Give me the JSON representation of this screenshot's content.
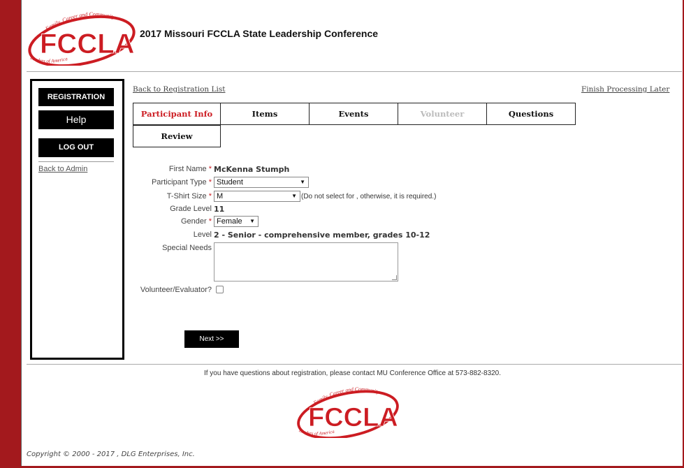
{
  "brand": {
    "logo_text": "FCCLA",
    "logo_arc_text": "Family, Career and Community",
    "logo_sub_text": "Leaders of America",
    "accent_color": "#cc1c22",
    "border_color": "#a3191d"
  },
  "header": {
    "title": "2017 Missouri FCCLA State Leadership Conference"
  },
  "sidebar": {
    "registration_label": "REGISTRATION",
    "help_label": "Help",
    "logout_label": "LOG OUT",
    "back_admin_label": "Back to Admin"
  },
  "top_links": {
    "back_to_list": "Back to Registration List",
    "finish_later": "Finish Processing Later"
  },
  "tabs": [
    {
      "label": "Participant Info",
      "state": "active"
    },
    {
      "label": "Items",
      "state": "normal"
    },
    {
      "label": "Events",
      "state": "normal"
    },
    {
      "label": "Volunteer",
      "state": "disabled"
    },
    {
      "label": "Questions",
      "state": "normal"
    },
    {
      "label": "Review",
      "state": "normal"
    }
  ],
  "form": {
    "first_name_label": "First Name",
    "first_name_value": "McKenna  Stumph",
    "participant_type_label": "Participant Type",
    "participant_type_value": "Student",
    "tshirt_label": "T-Shirt Size",
    "tshirt_value": "M",
    "tshirt_note": "(Do not select for , otherwise, it is required.)",
    "grade_label": "Grade Level",
    "grade_value": "11",
    "gender_label": "Gender",
    "gender_value": "Female",
    "level_label": "Level",
    "level_value": "2 - Senior - comprehensive member, grades 10-12",
    "special_needs_label": "Special Needs",
    "special_needs_value": "",
    "volunteer_label": "Volunteer/Evaluator?",
    "required_marker": "*"
  },
  "actions": {
    "next_label": "Next >>"
  },
  "footer": {
    "contact": "If you have questions about registration, please contact MU Conference Office at 573-882-8320.",
    "copyright": "Copyright © 2000 - 2017 , DLG Enterprises, Inc."
  },
  "icons": {
    "dropdown": "triangle-down-icon",
    "resize": "resize-grip-icon"
  }
}
